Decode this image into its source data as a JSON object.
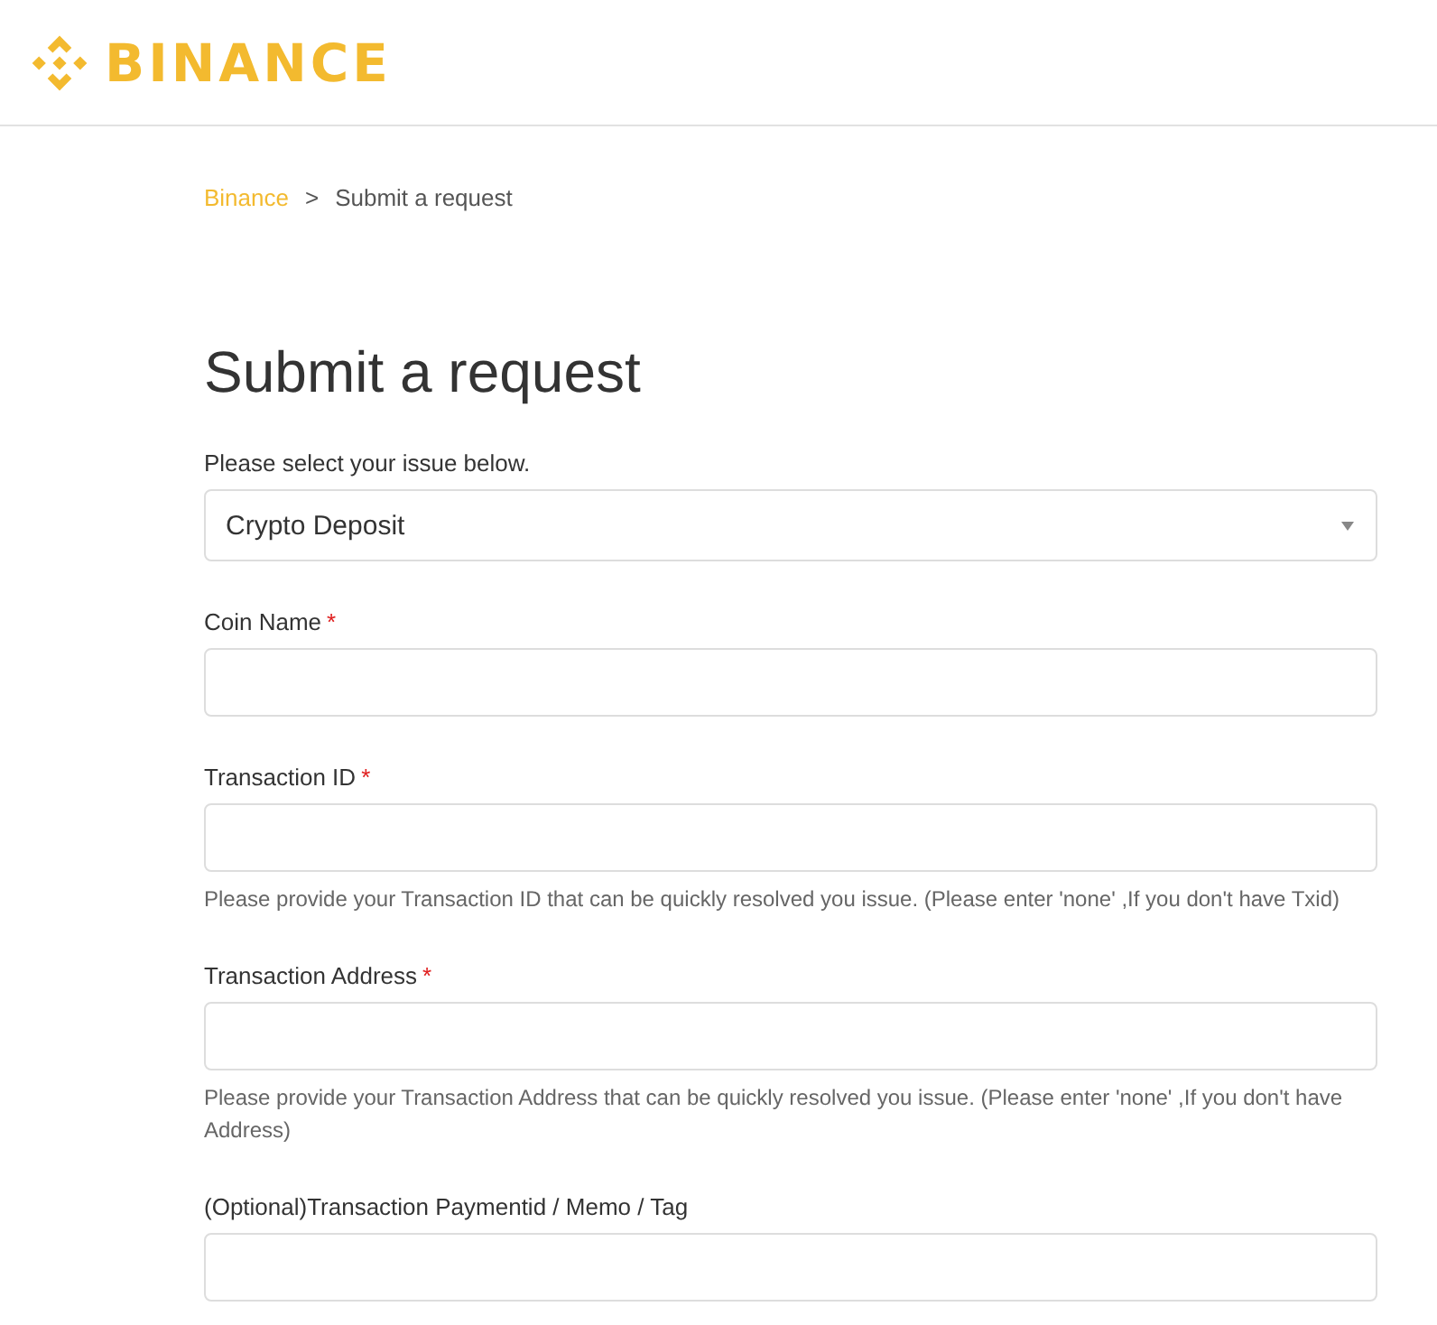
{
  "logo": {
    "text": "BINANCE"
  },
  "breadcrumb": {
    "home": "Binance",
    "separator": ">",
    "current": "Submit a request"
  },
  "title": "Submit a request",
  "issue_select": {
    "label": "Please select your issue below.",
    "value": "Crypto Deposit"
  },
  "fields": [
    {
      "label": "Coin Name",
      "required_mark": "*"
    },
    {
      "label": "Transaction ID",
      "required_mark": "*",
      "help": "Please provide your Transaction ID that can be quickly resolved you issue. (Please enter 'none' ,If you don't have Txid)"
    },
    {
      "label": "Transaction Address",
      "required_mark": "*",
      "help": "Please provide your Transaction Address that can be quickly resolved you issue. (Please enter 'none' ,If you don't have Address)"
    },
    {
      "label": "(Optional)Transaction Paymentid / Memo / Tag"
    }
  ]
}
